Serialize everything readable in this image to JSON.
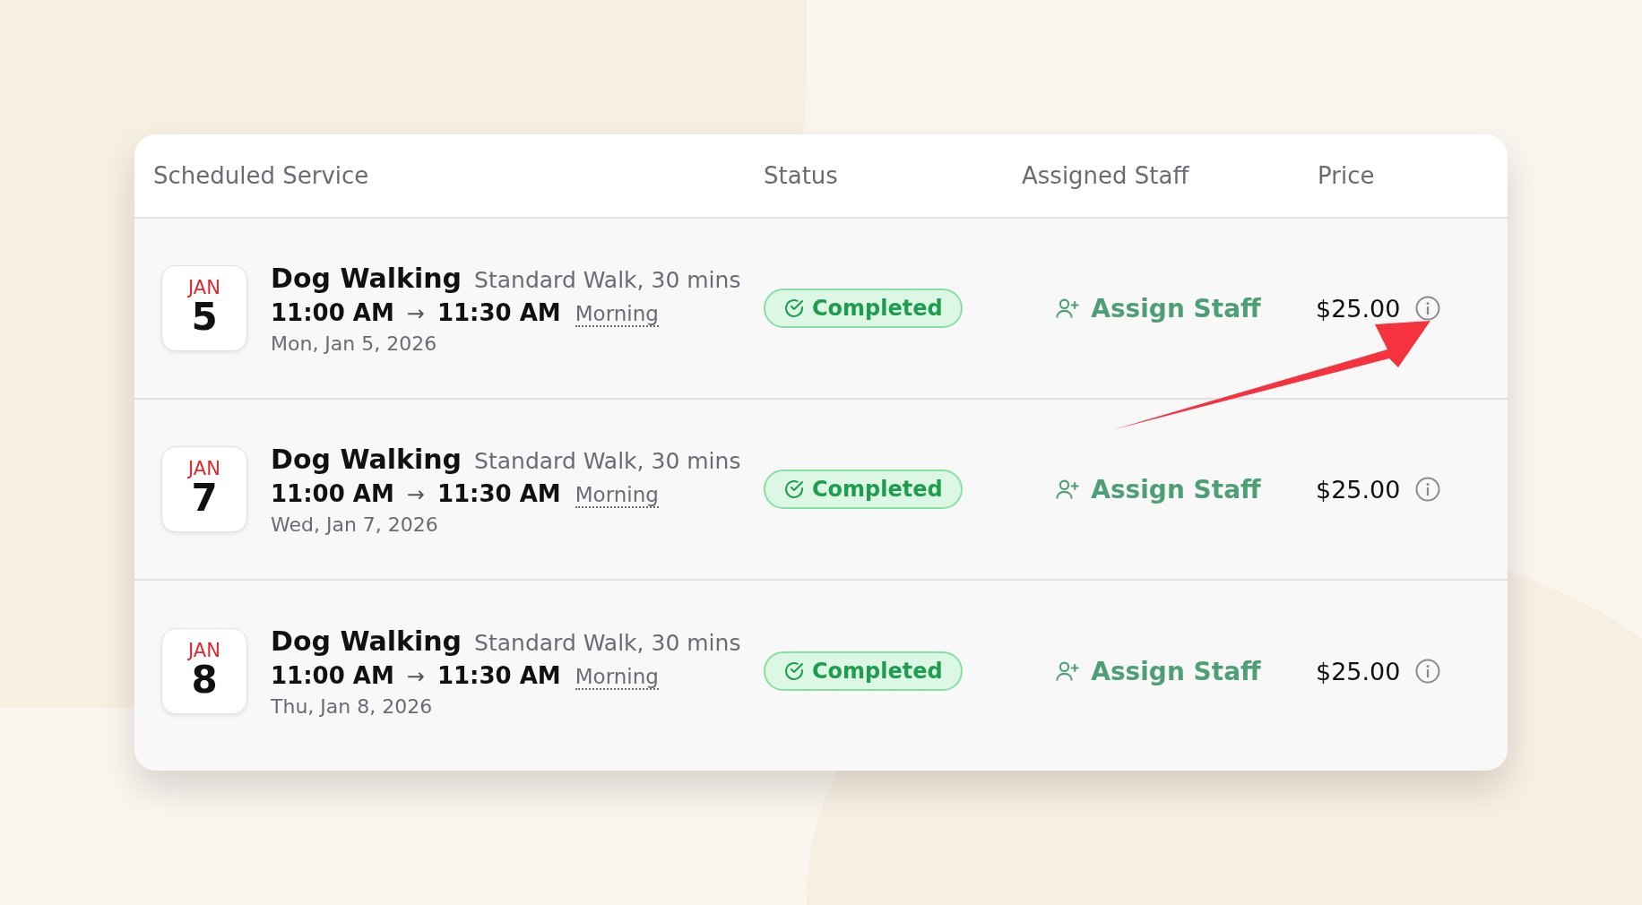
{
  "table": {
    "columns": [
      "Scheduled Service",
      "Status",
      "Assigned Staff",
      "Price"
    ],
    "rows": [
      {
        "month": "JAN",
        "day": "5",
        "service": "Dog Walking",
        "detail": "Standard Walk, 30 mins",
        "start": "11:00 AM",
        "arrow": "→",
        "end": "11:30 AM",
        "period": "Morning",
        "date": "Mon, Jan 5, 2026",
        "status": "Completed",
        "staff_action": "Assign Staff",
        "price": "$25.00"
      },
      {
        "month": "JAN",
        "day": "7",
        "service": "Dog Walking",
        "detail": "Standard Walk, 30 mins",
        "start": "11:00 AM",
        "arrow": "→",
        "end": "11:30 AM",
        "period": "Morning",
        "date": "Wed, Jan 7, 2026",
        "status": "Completed",
        "staff_action": "Assign Staff",
        "price": "$25.00"
      },
      {
        "month": "JAN",
        "day": "8",
        "service": "Dog Walking",
        "detail": "Standard Walk, 30 mins",
        "start": "11:00 AM",
        "arrow": "→",
        "end": "11:30 AM",
        "period": "Morning",
        "date": "Thu, Jan 8, 2026",
        "status": "Completed",
        "staff_action": "Assign Staff",
        "price": "$25.00"
      }
    ]
  },
  "annotation": {
    "kind": "arrow",
    "color": "#f5333f"
  }
}
